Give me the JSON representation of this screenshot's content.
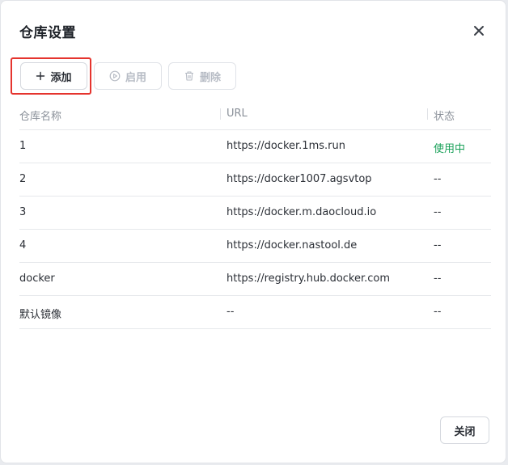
{
  "dialog": {
    "title": "仓库设置",
    "close_icon": "close-icon"
  },
  "toolbar": {
    "add_label": "添加",
    "enable_label": "启用",
    "delete_label": "删除"
  },
  "table": {
    "columns": [
      "仓库名称",
      "URL",
      "状态"
    ],
    "rows": [
      {
        "name": "1",
        "url": "https://docker.1ms.run",
        "status": "使用中"
      },
      {
        "name": "2",
        "url": "https://docker1007.agsvtop",
        "status": "--"
      },
      {
        "name": "3",
        "url": "https://docker.m.daocloud.io",
        "status": "--"
      },
      {
        "name": "4",
        "url": "https://docker.nastool.de",
        "status": "--"
      },
      {
        "name": "docker",
        "url": "https://registry.hub.docker.com",
        "status": "--"
      },
      {
        "name": "默认镜像",
        "url": "--",
        "status": "--"
      }
    ]
  },
  "footer": {
    "close_label": "关闭"
  },
  "colors": {
    "active_status": "#18a058",
    "highlight": "#e5342e"
  }
}
